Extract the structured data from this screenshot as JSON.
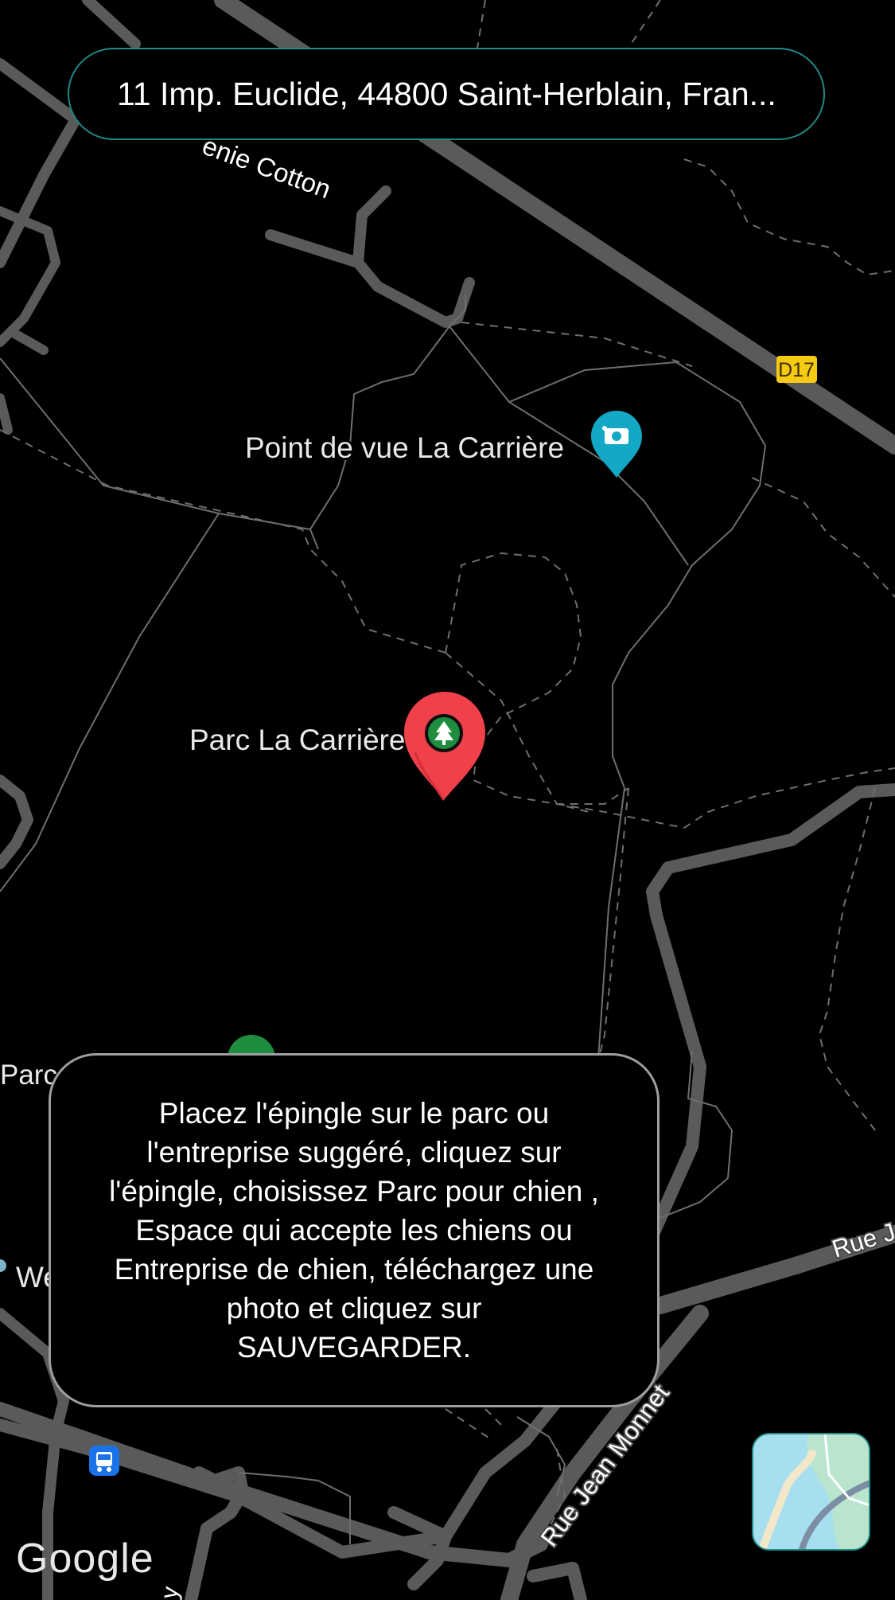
{
  "search": {
    "address": "11 Imp. Euclide, 44800 Saint-Herblain, Fran..."
  },
  "map": {
    "labels": {
      "street_cotton": "enie Cotton",
      "road_badge": "D17",
      "poi_viewpoint": "Point de vue La Carrière",
      "poi_park": "Parc La Carrière",
      "poi_park_partial": "Parc l",
      "poi_partial_w": "We",
      "street_rue_partial": "Rue J",
      "street_jean_monnet": "Rue Jean Monnet",
      "street_bottom_partial": "y"
    },
    "colors": {
      "road": "#5a5a5a",
      "path": "#6e6e6e",
      "background": "#000000",
      "pin": "#f0404a",
      "park_icon": "#1e8e3e",
      "viewpoint_icon": "#12a8c6",
      "transit_icon": "#1a73e8",
      "badge": "#f6c912"
    }
  },
  "instruction": {
    "text": "Placez l'épingle sur le parc ou l'entreprise suggéré, cliquez sur l'épingle, choisissez Parc pour chien , Espace qui accepte les chiens ou Entreprise de chien, téléchargez une photo et cliquez sur SAUVEGARDER."
  },
  "attribution": {
    "logo": "Google"
  },
  "map_type_button": {
    "icon": "satellite-map-thumbnail-icon"
  }
}
